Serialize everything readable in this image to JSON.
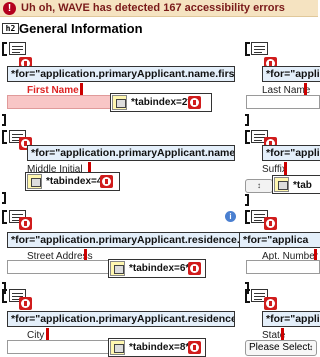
{
  "wave_banner": {
    "icon": "!",
    "text": "Uh oh, WAVE has detected 167 accessibility errors"
  },
  "heading_tag": "h2",
  "section_title": "General Information",
  "first_name": {
    "for_text": "*for=\"application.primaryApplicant.name.firstName\"*",
    "label": "First Name",
    "tabindex": "*tabindex=2*"
  },
  "last_name": {
    "for_text": "*for=\"applica",
    "label": "Last Name"
  },
  "middle_initial": {
    "for_text": "*for=\"application.primaryApplicant.name.middleInitial\"*",
    "label": "Middle Initial",
    "tabindex": "*tabindex=4*"
  },
  "suffix": {
    "for_text": "*for=\"applica",
    "label": "Suffix",
    "tabindex": "*tab"
  },
  "street_address": {
    "for_text": "*for=\"application.primaryApplicant.residence.address.address",
    "label": "Street Address",
    "tabindex": "*tabindex=6*"
  },
  "apt_number": {
    "for_text": "*for=\"applica",
    "label": "Apt. Number"
  },
  "city": {
    "for_text": "*for=\"application.primaryApplicant.residence.address.city\"*",
    "label": "City",
    "tabindex": "*tabindex=8*"
  },
  "state": {
    "for_text": "*for=\"applica",
    "label": "State",
    "select_value": "Please Select"
  },
  "icons": {
    "error": "error-icon",
    "structure": "structure-icon",
    "keyboard": "keyboard-icon",
    "info": "info-icon"
  },
  "colors": {
    "error_red": "#d01c1c",
    "label_blue": "#e4effa",
    "banner": "#f5e3c1"
  }
}
